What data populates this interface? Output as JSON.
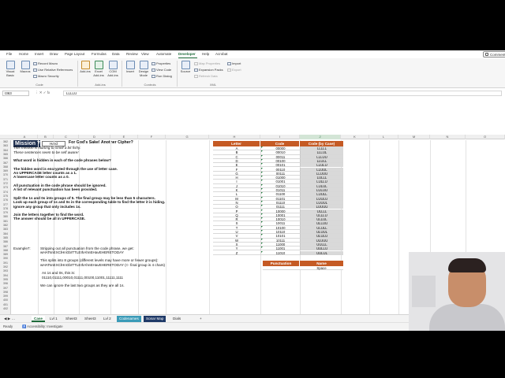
{
  "ribbon_tabs": [
    "File",
    "Home",
    "Insert",
    "Draw",
    "Page Layout",
    "Formulas",
    "Data",
    "Review",
    "View",
    "Automate",
    "Developer",
    "Help",
    "Acrobat"
  ],
  "active_tab": "Developer",
  "comments_label": "Comments",
  "ribbon": {
    "code_group": {
      "visual_basic": "Visual Basic",
      "macros": "Macros",
      "record_macro": "Record Macro",
      "use_relative": "Use Relative References",
      "macro_security": "Macro Security",
      "label": "Code"
    },
    "addins_group": {
      "addins": "Add-ins",
      "excel_addins": "Excel Add-ins",
      "com_addins": "COM Add-ins",
      "label": "Add-ins"
    },
    "controls_group": {
      "insert": "Insert",
      "design_mode": "Design Mode",
      "properties": "Properties",
      "view_code": "View Code",
      "run_dialog": "Run Dialog",
      "label": "Controls"
    },
    "xml_group": {
      "source": "Source",
      "map_properties": "Map Properties",
      "expansion_packs": "Expansion Packs",
      "refresh_data": "Refresh Data",
      "import": "Import",
      "export": "Export",
      "label": "XML"
    }
  },
  "formula_bar": {
    "name_box": "I363",
    "icons": "⋮  ✕  ✓  fx",
    "content": "LLLLU"
  },
  "columns": [
    "A",
    "B",
    "C",
    "D",
    "E",
    "F",
    "G",
    "H",
    "I",
    "J",
    "K",
    "L",
    "M",
    "N",
    "O"
  ],
  "selected_column": "J",
  "row_numbers": [
    "362",
    "363",
    "364",
    "365",
    "366",
    "367",
    "368",
    "369",
    "370",
    "371",
    "372",
    "373",
    "374",
    "375",
    "376",
    "377",
    "378",
    "379",
    "380",
    "381",
    "382",
    "383",
    "384",
    "385",
    "386",
    "387",
    "388",
    "389",
    "390",
    "391",
    "392",
    "393",
    "394",
    "395",
    "396",
    "397",
    "398",
    "399",
    "400",
    "401",
    "402"
  ],
  "mission": {
    "badge": "Mission 7",
    "difficulty": "Hard",
    "title": "For God's Sake! Another Cipher?",
    "lines": [
      {
        "text": "This mission is starting to smell a bit fishy.",
        "style": "i"
      },
      {
        "text": "These sentences seem to be self aware!",
        "style": "i"
      },
      {
        "text": "",
        "style": ""
      },
      {
        "text": "What word is hidden in each of the code phrases below?",
        "style": "b"
      },
      {
        "text": "",
        "style": ""
      },
      {
        "text": "The hidden word is encrypted through the use of letter case.",
        "style": "b"
      },
      {
        "text": "An UPPERCASE letter counts as a 1.",
        "style": "b"
      },
      {
        "text": "A lowercase letter counts as a 0.",
        "style": "b"
      },
      {
        "text": "",
        "style": ""
      },
      {
        "text": "All punctuation in the code phrase should be ignored.",
        "style": "b"
      },
      {
        "text": "A list of relevant punctuation has been provided.",
        "style": "b"
      },
      {
        "text": "",
        "style": ""
      },
      {
        "text": "Split the 1s and 0s into groups of 5. The final group may be less than 5 characters.",
        "style": "b"
      },
      {
        "text": "Look up each group of 1s and 0s in the corresponding table to find the letter it is hiding.",
        "style": "b"
      },
      {
        "text": "Ignore any group that only includes 1s.",
        "style": "b"
      },
      {
        "text": "",
        "style": ""
      },
      {
        "text": "Join the letters together to find the word.",
        "style": "b"
      },
      {
        "text": "The answer should be all in UPPERCASE.",
        "style": "b"
      }
    ],
    "example_label": "Example7:",
    "example_lines": [
      "Stripping out all punctuation from the code phrase, we get:",
      "wHATsnEXClHnGbITTLEIhAhnEHavEHERETODAY",
      "",
      "This splits into 8 groups (different levels may have more or fewer groups):",
      "wHATsnEXClHnGbITTLEIhAhnEHavEHERETODAY  (<- final group is 4 chars)",
      "",
      "As 1s and 0s, this is:",
      "01110,01111,00010,01111,00100,11001,11111,1111",
      "",
      "We can ignore the last two groups as they are all 1s."
    ]
  },
  "code_table": {
    "headers": [
      "Letter",
      "Code",
      "Code (by Case)"
    ],
    "rows": [
      [
        "A",
        "00000",
        "LLLLL"
      ],
      [
        "B",
        "00010",
        "LLLUL"
      ],
      [
        "C",
        "00011",
        "LLLUU"
      ],
      [
        "D",
        "00100",
        "LLULL"
      ],
      [
        "E",
        "00101",
        "LLULU"
      ],
      [
        "F",
        "00110",
        "LLUUL"
      ],
      [
        "G",
        "00111",
        "LLUUU"
      ],
      [
        "H",
        "01000",
        "LULLL"
      ],
      [
        "I",
        "01001",
        "LULLU"
      ],
      [
        "J",
        "01010",
        "LULUL"
      ],
      [
        "K",
        "01011",
        "LULUU"
      ],
      [
        "L",
        "01100",
        "LUULL"
      ],
      [
        "M",
        "01101",
        "LUULU"
      ],
      [
        "N",
        "01110",
        "LUUUL"
      ],
      [
        "O",
        "01111",
        "LUUUU"
      ],
      [
        "P",
        "10000",
        "ULLLL"
      ],
      [
        "Q",
        "10001",
        "ULLLU"
      ],
      [
        "R",
        "10010",
        "ULLUL"
      ],
      [
        "S",
        "10011",
        "ULLUU"
      ],
      [
        "T",
        "10100",
        "ULULL"
      ],
      [
        "U",
        "10110",
        "ULUUL"
      ],
      [
        "V",
        "10101",
        "ULULU"
      ],
      [
        "W",
        "10111",
        "ULUUU"
      ],
      [
        "X",
        "11000",
        "UULLL"
      ],
      [
        "Y",
        "11001",
        "UULLU"
      ],
      [
        "Z",
        "11010",
        "UULUL"
      ]
    ]
  },
  "punct_table": {
    "headers": [
      "Punctuation",
      "Name"
    ],
    "first_row": [
      "",
      "Space"
    ]
  },
  "sheet_tabs": [
    {
      "label": "Case",
      "style": "active"
    },
    {
      "label": "Lvl 1",
      "style": ""
    },
    {
      "label": "Sheet3",
      "style": ""
    },
    {
      "label": "Sheet3",
      "style": ""
    },
    {
      "label": "Lvl 2",
      "style": ""
    },
    {
      "label": "Codenames",
      "style": "teal"
    },
    {
      "label": "Sonar Map",
      "style": "navy"
    },
    {
      "label": "Dials",
      "style": ""
    }
  ],
  "add_sheet": "+",
  "status": {
    "ready": "Ready",
    "accessibility": "Accessibility: Investigate"
  },
  "colors": {
    "accent_green": "#1e6b3a",
    "table_header": "#c55a24",
    "mission_badge": "#1f2f4f"
  }
}
